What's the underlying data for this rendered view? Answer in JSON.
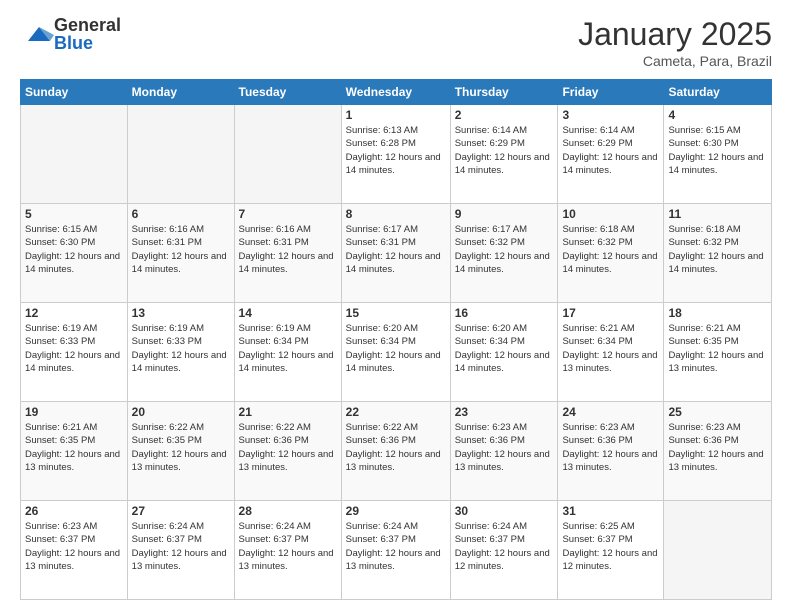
{
  "header": {
    "logo_general": "General",
    "logo_blue": "Blue",
    "month_year": "January 2025",
    "location": "Cameta, Para, Brazil"
  },
  "days_of_week": [
    "Sunday",
    "Monday",
    "Tuesday",
    "Wednesday",
    "Thursday",
    "Friday",
    "Saturday"
  ],
  "weeks": [
    [
      {
        "day": "",
        "info": ""
      },
      {
        "day": "",
        "info": ""
      },
      {
        "day": "",
        "info": ""
      },
      {
        "day": "1",
        "info": "Sunrise: 6:13 AM\nSunset: 6:28 PM\nDaylight: 12 hours and 14 minutes."
      },
      {
        "day": "2",
        "info": "Sunrise: 6:14 AM\nSunset: 6:29 PM\nDaylight: 12 hours and 14 minutes."
      },
      {
        "day": "3",
        "info": "Sunrise: 6:14 AM\nSunset: 6:29 PM\nDaylight: 12 hours and 14 minutes."
      },
      {
        "day": "4",
        "info": "Sunrise: 6:15 AM\nSunset: 6:30 PM\nDaylight: 12 hours and 14 minutes."
      }
    ],
    [
      {
        "day": "5",
        "info": "Sunrise: 6:15 AM\nSunset: 6:30 PM\nDaylight: 12 hours and 14 minutes."
      },
      {
        "day": "6",
        "info": "Sunrise: 6:16 AM\nSunset: 6:31 PM\nDaylight: 12 hours and 14 minutes."
      },
      {
        "day": "7",
        "info": "Sunrise: 6:16 AM\nSunset: 6:31 PM\nDaylight: 12 hours and 14 minutes."
      },
      {
        "day": "8",
        "info": "Sunrise: 6:17 AM\nSunset: 6:31 PM\nDaylight: 12 hours and 14 minutes."
      },
      {
        "day": "9",
        "info": "Sunrise: 6:17 AM\nSunset: 6:32 PM\nDaylight: 12 hours and 14 minutes."
      },
      {
        "day": "10",
        "info": "Sunrise: 6:18 AM\nSunset: 6:32 PM\nDaylight: 12 hours and 14 minutes."
      },
      {
        "day": "11",
        "info": "Sunrise: 6:18 AM\nSunset: 6:32 PM\nDaylight: 12 hours and 14 minutes."
      }
    ],
    [
      {
        "day": "12",
        "info": "Sunrise: 6:19 AM\nSunset: 6:33 PM\nDaylight: 12 hours and 14 minutes."
      },
      {
        "day": "13",
        "info": "Sunrise: 6:19 AM\nSunset: 6:33 PM\nDaylight: 12 hours and 14 minutes."
      },
      {
        "day": "14",
        "info": "Sunrise: 6:19 AM\nSunset: 6:34 PM\nDaylight: 12 hours and 14 minutes."
      },
      {
        "day": "15",
        "info": "Sunrise: 6:20 AM\nSunset: 6:34 PM\nDaylight: 12 hours and 14 minutes."
      },
      {
        "day": "16",
        "info": "Sunrise: 6:20 AM\nSunset: 6:34 PM\nDaylight: 12 hours and 14 minutes."
      },
      {
        "day": "17",
        "info": "Sunrise: 6:21 AM\nSunset: 6:34 PM\nDaylight: 12 hours and 13 minutes."
      },
      {
        "day": "18",
        "info": "Sunrise: 6:21 AM\nSunset: 6:35 PM\nDaylight: 12 hours and 13 minutes."
      }
    ],
    [
      {
        "day": "19",
        "info": "Sunrise: 6:21 AM\nSunset: 6:35 PM\nDaylight: 12 hours and 13 minutes."
      },
      {
        "day": "20",
        "info": "Sunrise: 6:22 AM\nSunset: 6:35 PM\nDaylight: 12 hours and 13 minutes."
      },
      {
        "day": "21",
        "info": "Sunrise: 6:22 AM\nSunset: 6:36 PM\nDaylight: 12 hours and 13 minutes."
      },
      {
        "day": "22",
        "info": "Sunrise: 6:22 AM\nSunset: 6:36 PM\nDaylight: 12 hours and 13 minutes."
      },
      {
        "day": "23",
        "info": "Sunrise: 6:23 AM\nSunset: 6:36 PM\nDaylight: 12 hours and 13 minutes."
      },
      {
        "day": "24",
        "info": "Sunrise: 6:23 AM\nSunset: 6:36 PM\nDaylight: 12 hours and 13 minutes."
      },
      {
        "day": "25",
        "info": "Sunrise: 6:23 AM\nSunset: 6:36 PM\nDaylight: 12 hours and 13 minutes."
      }
    ],
    [
      {
        "day": "26",
        "info": "Sunrise: 6:23 AM\nSunset: 6:37 PM\nDaylight: 12 hours and 13 minutes."
      },
      {
        "day": "27",
        "info": "Sunrise: 6:24 AM\nSunset: 6:37 PM\nDaylight: 12 hours and 13 minutes."
      },
      {
        "day": "28",
        "info": "Sunrise: 6:24 AM\nSunset: 6:37 PM\nDaylight: 12 hours and 13 minutes."
      },
      {
        "day": "29",
        "info": "Sunrise: 6:24 AM\nSunset: 6:37 PM\nDaylight: 12 hours and 13 minutes."
      },
      {
        "day": "30",
        "info": "Sunrise: 6:24 AM\nSunset: 6:37 PM\nDaylight: 12 hours and 12 minutes."
      },
      {
        "day": "31",
        "info": "Sunrise: 6:25 AM\nSunset: 6:37 PM\nDaylight: 12 hours and 12 minutes."
      },
      {
        "day": "",
        "info": ""
      }
    ]
  ]
}
